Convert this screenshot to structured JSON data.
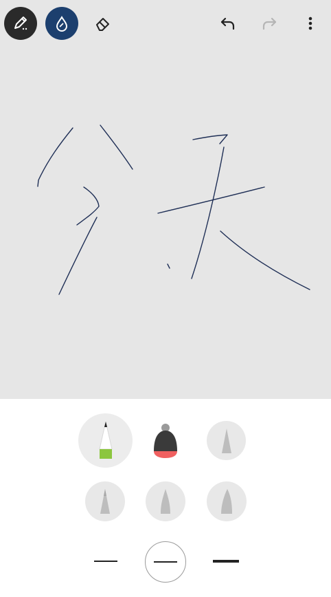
{
  "toolbar": {
    "icons": [
      "pen-settings-icon",
      "ink-drop-icon",
      "eraser-icon",
      "undo-icon",
      "redo-icon",
      "more-vertical-icon"
    ],
    "colors": {
      "pen_mode_bg": "#2a2a2a",
      "ink_mode_bg": "#1c3f6e",
      "redo_disabled": "#b5b5b5"
    }
  },
  "canvas": {
    "background": "#e6e6e6",
    "ink_color": "#1f2f56"
  },
  "pen_panel": {
    "pens": [
      "ballpoint-pen",
      "marker-pen",
      "calligraphy-pen",
      "pencil",
      "fountain-pen",
      "brush-pen"
    ],
    "selected_pen": "ballpoint-pen",
    "colors": {
      "selected_accent": "#8cc63f",
      "marker_accent": "#f06060"
    },
    "thickness_options": [
      "thin",
      "medium",
      "thick"
    ],
    "selected_thickness": "medium"
  }
}
